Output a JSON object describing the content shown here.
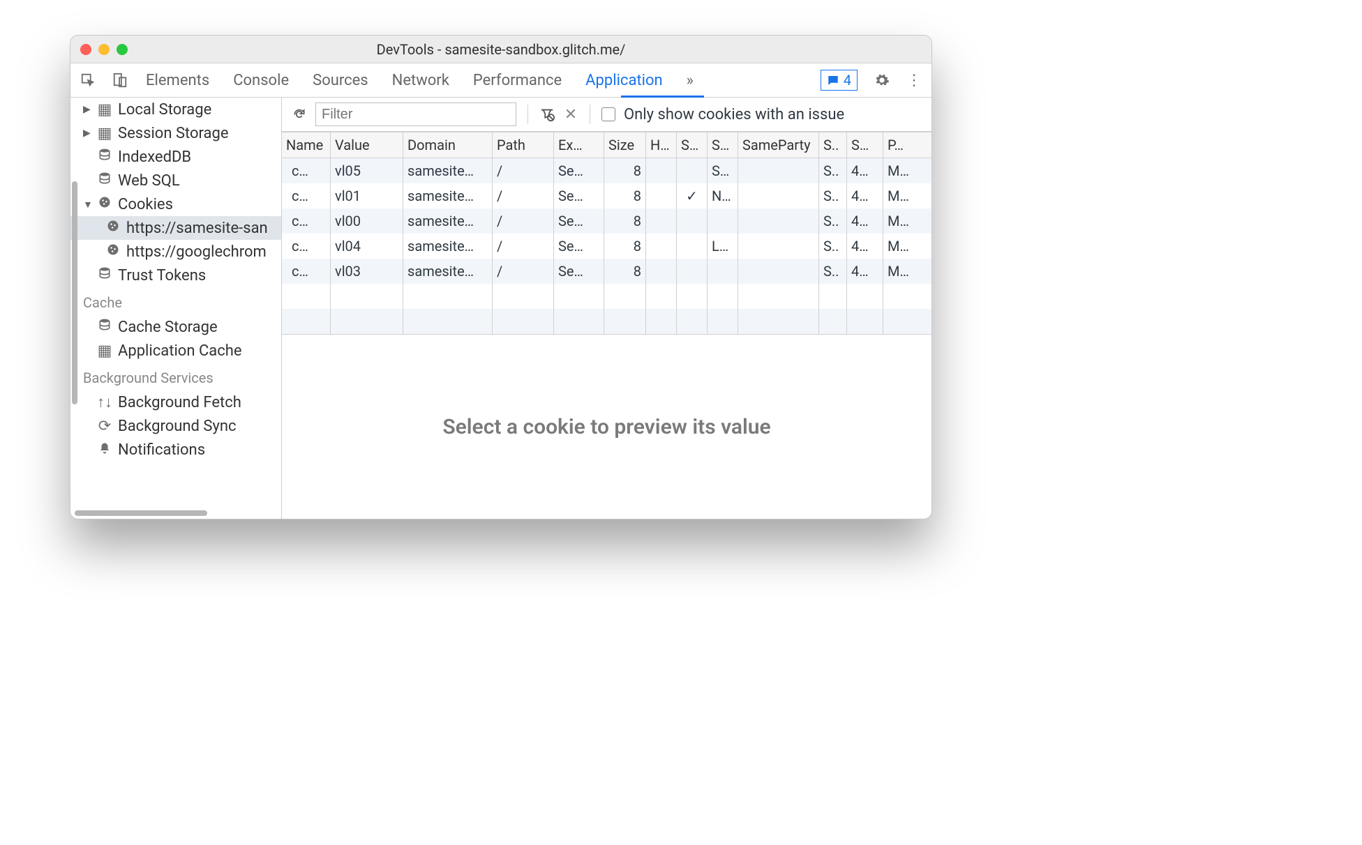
{
  "window": {
    "title": "DevTools - samesite-sandbox.glitch.me/"
  },
  "tabs": [
    "Elements",
    "Console",
    "Sources",
    "Network",
    "Performance",
    "Application",
    "»"
  ],
  "active_tab": "Application",
  "issues": {
    "count": "4"
  },
  "sidebar": {
    "storage": [
      {
        "icon": "grid",
        "label": "Local Storage",
        "expand": "▶"
      },
      {
        "icon": "grid",
        "label": "Session Storage",
        "expand": "▶"
      },
      {
        "icon": "db",
        "label": "IndexedDB"
      },
      {
        "icon": "db",
        "label": "Web SQL"
      },
      {
        "icon": "cookie",
        "label": "Cookies",
        "expand": "▼"
      }
    ],
    "cookies": [
      {
        "label": "https://samesite-san",
        "sel": true
      },
      {
        "label": "https://googlechrom",
        "sel": false
      }
    ],
    "trust": {
      "label": "Trust Tokens"
    },
    "cache_header": "Cache",
    "cache": [
      {
        "icon": "db",
        "label": "Cache Storage"
      },
      {
        "icon": "grid",
        "label": "Application Cache"
      }
    ],
    "bg_header": "Background Services",
    "bg": [
      {
        "icon": "fetch",
        "label": "Background Fetch"
      },
      {
        "icon": "sync",
        "label": "Background Sync"
      },
      {
        "icon": "bell",
        "label": "Notifications"
      }
    ]
  },
  "filter": {
    "placeholder": "Filter",
    "checkbox_label": "Only show cookies with an issue"
  },
  "cookie_table": {
    "headers": [
      "Name",
      "Value",
      "Domain",
      "Path",
      "Ex…",
      "Size",
      "H…",
      "S…",
      "S…",
      "SameParty",
      "S..",
      "S…",
      "P…"
    ],
    "rows": [
      {
        "name": "c…",
        "value": "vl05",
        "domain": "samesite…",
        "path": "/",
        "expires": "Se…",
        "size": "8",
        "http": "",
        "s1": "",
        "s2": "S…",
        "sameparty": "",
        "sc": "S..",
        "sp": "4…",
        "p": "M…"
      },
      {
        "name": "c…",
        "value": "vl01",
        "domain": "samesite…",
        "path": "/",
        "expires": "Se…",
        "size": "8",
        "http": "",
        "s1": "✓",
        "s2": "N…",
        "sameparty": "",
        "sc": "S..",
        "sp": "4…",
        "p": "M…"
      },
      {
        "name": "c…",
        "value": "vl00",
        "domain": "samesite…",
        "path": "/",
        "expires": "Se…",
        "size": "8",
        "http": "",
        "s1": "",
        "s2": "",
        "sameparty": "",
        "sc": "S..",
        "sp": "4…",
        "p": "M…"
      },
      {
        "name": "c…",
        "value": "vl04",
        "domain": "samesite…",
        "path": "/",
        "expires": "Se…",
        "size": "8",
        "http": "",
        "s1": "",
        "s2": "L…",
        "sameparty": "",
        "sc": "S..",
        "sp": "4…",
        "p": "M…"
      },
      {
        "name": "c…",
        "value": "vl03",
        "domain": "samesite…",
        "path": "/",
        "expires": "Se…",
        "size": "8",
        "http": "",
        "s1": "",
        "s2": "",
        "sameparty": "",
        "sc": "S..",
        "sp": "4…",
        "p": "M…"
      }
    ]
  },
  "preview": "Select a cookie to preview its value"
}
